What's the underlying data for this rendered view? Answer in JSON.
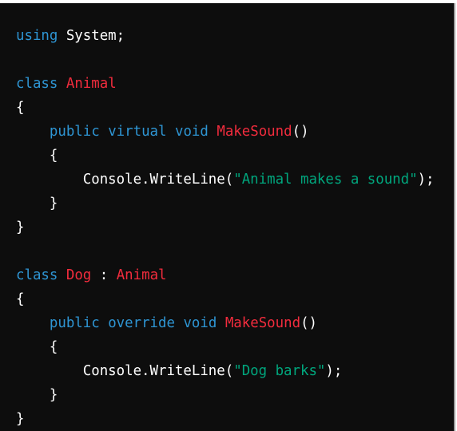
{
  "code": {
    "lines": [
      [
        {
          "t": "kw",
          "v": "using"
        },
        {
          "t": "pl",
          "v": " System;"
        }
      ],
      [],
      [
        {
          "t": "kw",
          "v": "class"
        },
        {
          "t": "pl",
          "v": " "
        },
        {
          "t": "ty",
          "v": "Animal"
        }
      ],
      [
        {
          "t": "pl",
          "v": "{"
        }
      ],
      [
        {
          "t": "pl",
          "v": "    "
        },
        {
          "t": "kw",
          "v": "public"
        },
        {
          "t": "pl",
          "v": " "
        },
        {
          "t": "kw",
          "v": "virtual"
        },
        {
          "t": "pl",
          "v": " "
        },
        {
          "t": "kw",
          "v": "void"
        },
        {
          "t": "pl",
          "v": " "
        },
        {
          "t": "ty",
          "v": "MakeSound"
        },
        {
          "t": "pl",
          "v": "()"
        }
      ],
      [
        {
          "t": "pl",
          "v": "    {"
        }
      ],
      [
        {
          "t": "pl",
          "v": "        Console.WriteLine("
        },
        {
          "t": "str",
          "v": "\"Animal makes a sound\""
        },
        {
          "t": "pl",
          "v": ");"
        }
      ],
      [
        {
          "t": "pl",
          "v": "    }"
        }
      ],
      [
        {
          "t": "pl",
          "v": "}"
        }
      ],
      [],
      [
        {
          "t": "kw",
          "v": "class"
        },
        {
          "t": "pl",
          "v": " "
        },
        {
          "t": "ty",
          "v": "Dog"
        },
        {
          "t": "pl",
          "v": " : "
        },
        {
          "t": "ty",
          "v": "Animal"
        }
      ],
      [
        {
          "t": "pl",
          "v": "{"
        }
      ],
      [
        {
          "t": "pl",
          "v": "    "
        },
        {
          "t": "kw",
          "v": "public"
        },
        {
          "t": "pl",
          "v": " "
        },
        {
          "t": "kw",
          "v": "override"
        },
        {
          "t": "pl",
          "v": " "
        },
        {
          "t": "kw",
          "v": "void"
        },
        {
          "t": "pl",
          "v": " "
        },
        {
          "t": "ty",
          "v": "MakeSound"
        },
        {
          "t": "pl",
          "v": "()"
        }
      ],
      [
        {
          "t": "pl",
          "v": "    {"
        }
      ],
      [
        {
          "t": "pl",
          "v": "        Console.WriteLine("
        },
        {
          "t": "str",
          "v": "\"Dog barks\""
        },
        {
          "t": "pl",
          "v": ");"
        }
      ],
      [
        {
          "t": "pl",
          "v": "    }"
        }
      ],
      [
        {
          "t": "pl",
          "v": "}"
        }
      ]
    ]
  },
  "colors": {
    "background": "#0d0d0d",
    "keyword": "#2e95d3",
    "type": "#f22c3d",
    "string": "#00a67d",
    "plain": "#ffffff"
  }
}
